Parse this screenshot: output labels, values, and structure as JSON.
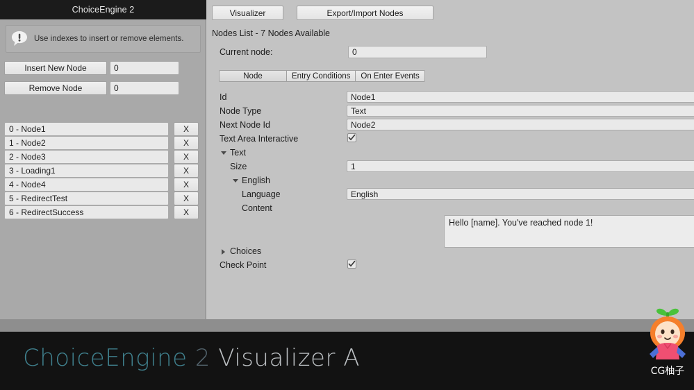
{
  "window": {
    "title": "ChoiceEngine 2"
  },
  "left_panel": {
    "help_text": "Use indexes to insert or remove elements.",
    "help_icon": "info-bubble-icon",
    "insert_button_label": "Insert New Node",
    "insert_index_value": "0",
    "remove_button_label": "Remove Node",
    "remove_index_value": "0",
    "delete_button_label": "X",
    "nodes": [
      {
        "label": "0 - Node1"
      },
      {
        "label": "1 - Node2"
      },
      {
        "label": "2 - Node3"
      },
      {
        "label": "3 - Loading1"
      },
      {
        "label": "4 - Node4"
      },
      {
        "label": "5 - RedirectTest"
      },
      {
        "label": "6 - RedirectSuccess"
      }
    ]
  },
  "right_panel": {
    "visualizer_button": "Visualizer",
    "export_import_button": "Export/Import Nodes",
    "nodes_list_heading": "Nodes List - 7 Nodes Available",
    "current_node_label": "Current node:",
    "current_node_value": "0",
    "tabs": [
      {
        "label": "Node",
        "selected": true
      },
      {
        "label": "Entry Conditions",
        "selected": false
      },
      {
        "label": "On Enter Events",
        "selected": false
      }
    ],
    "properties": {
      "id_label": "Id",
      "id_value": "Node1",
      "node_type_label": "Node Type",
      "node_type_value": "Text",
      "next_node_id_label": "Next Node Id",
      "next_node_id_value": "Node2",
      "text_area_interactive_label": "Text Area Interactive",
      "text_area_interactive_checked": true,
      "text_foldout_label": "Text",
      "text_foldout_expanded": true,
      "size_label": "Size",
      "size_value": "1",
      "english_foldout_label": "English",
      "english_foldout_expanded": true,
      "language_label": "Language",
      "language_value": "English",
      "content_label": "Content",
      "content_value": "Hello [name]. You've reached node 1!",
      "choices_foldout_label": "Choices",
      "choices_foldout_expanded": false,
      "check_point_label": "Check Point",
      "check_point_checked": true
    }
  },
  "banner": {
    "brand_part1": "ChoiceEngine",
    "brand_part2": " 2",
    "brand_part3": " Visualizer A",
    "brand_color1": "#3f7f8c",
    "brand_color2": "#52626b",
    "brand_color3": "#b9bdc0"
  },
  "watermark": {
    "label": "CG柚子",
    "icon": "pomelo-mascot-icon"
  }
}
